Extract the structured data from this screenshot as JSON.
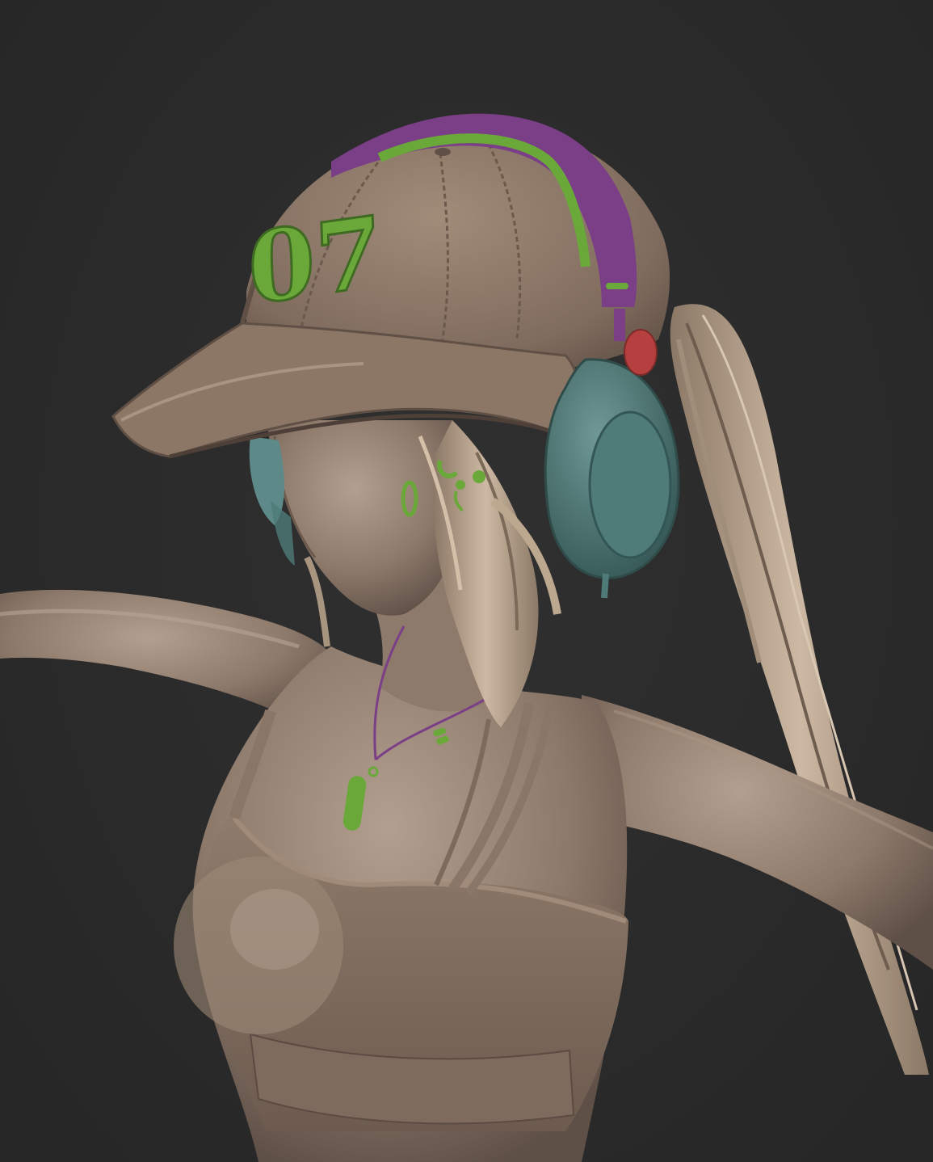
{
  "scene": {
    "subject": "sculpt-render",
    "colors": {
      "background": "#2b2b2b",
      "clay": "#8a7768",
      "clay_light": "#b09c8c",
      "clay_dark": "#5f5047",
      "hair": "#a8957f",
      "hair_light": "#c9b6a0",
      "accent_green": "#6aa83a",
      "accent_purple": "#7a3f86",
      "headphone_teal": "#4e7a78",
      "headphone_red": "#b5403f"
    }
  },
  "cap": {
    "number_text": "07"
  }
}
